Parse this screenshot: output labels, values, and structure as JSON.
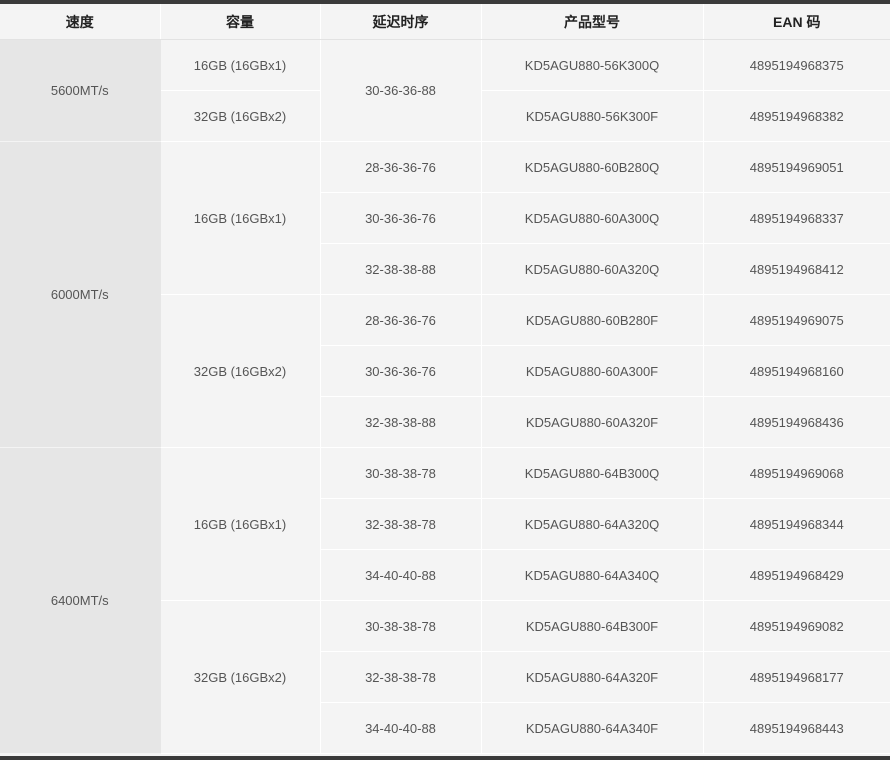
{
  "table": {
    "headers": {
      "speed": "速度",
      "capacity": "容量",
      "latency": "延迟时序",
      "model": "产品型号",
      "ean": "EAN 码"
    },
    "rows": [
      {
        "speed": "5600MT/s",
        "capacity": "16GB (16GBx1)",
        "latency": "30-36-36-88",
        "model": "KD5AGU880-56K300Q",
        "ean": "4895194968375"
      },
      {
        "speed": "5600MT/s",
        "capacity": "32GB (16GBx2)",
        "latency": "30-36-36-88",
        "model": "KD5AGU880-56K300F",
        "ean": "4895194968382"
      },
      {
        "speed": "6000MT/s",
        "capacity": "16GB (16GBx1)",
        "latency": "28-36-36-76",
        "model": "KD5AGU880-60B280Q",
        "ean": "4895194969051"
      },
      {
        "speed": "6000MT/s",
        "capacity": "16GB (16GBx1)",
        "latency": "30-36-36-76",
        "model": "KD5AGU880-60A300Q",
        "ean": "4895194968337"
      },
      {
        "speed": "6000MT/s",
        "capacity": "16GB (16GBx1)",
        "latency": "32-38-38-88",
        "model": "KD5AGU880-60A320Q",
        "ean": "4895194968412"
      },
      {
        "speed": "6000MT/s",
        "capacity": "32GB (16GBx2)",
        "latency": "28-36-36-76",
        "model": "KD5AGU880-60B280F",
        "ean": "4895194969075"
      },
      {
        "speed": "6000MT/s",
        "capacity": "32GB (16GBx2)",
        "latency": "30-36-36-76",
        "model": "KD5AGU880-60A300F",
        "ean": "4895194968160"
      },
      {
        "speed": "6000MT/s",
        "capacity": "32GB (16GBx2)",
        "latency": "32-38-38-88",
        "model": "KD5AGU880-60A320F",
        "ean": "4895194968436"
      },
      {
        "speed": "6400MT/s",
        "capacity": "16GB (16GBx1)",
        "latency": "30-38-38-78",
        "model": "KD5AGU880-64B300Q",
        "ean": "4895194969068"
      },
      {
        "speed": "6400MT/s",
        "capacity": "16GB (16GBx1)",
        "latency": "32-38-38-78",
        "model": "KD5AGU880-64A320Q",
        "ean": "4895194968344"
      },
      {
        "speed": "6400MT/s",
        "capacity": "16GB (16GBx1)",
        "latency": "34-40-40-88",
        "model": "KD5AGU880-64A340Q",
        "ean": "4895194968429"
      },
      {
        "speed": "6400MT/s",
        "capacity": "32GB (16GBx2)",
        "latency": "30-38-38-78",
        "model": "KD5AGU880-64B300F",
        "ean": "4895194969082"
      },
      {
        "speed": "6400MT/s",
        "capacity": "32GB (16GBx2)",
        "latency": "32-38-38-78",
        "model": "KD5AGU880-64A320F",
        "ean": "4895194968177"
      },
      {
        "speed": "6400MT/s",
        "capacity": "32GB (16GBx2)",
        "latency": "34-40-40-88",
        "model": "KD5AGU880-64A340F",
        "ean": "4895194968443"
      }
    ]
  }
}
